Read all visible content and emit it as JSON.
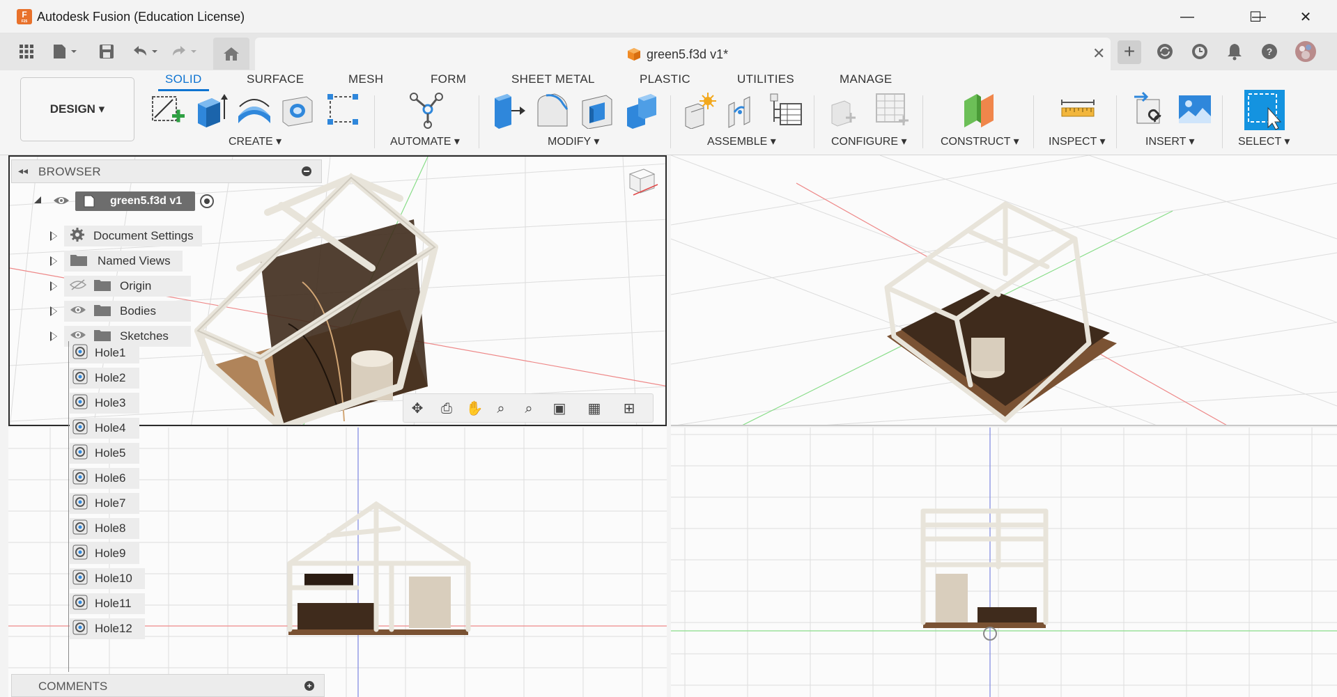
{
  "window": {
    "title": "Autodesk Fusion (Education License)",
    "logo_letter": "F",
    "logo_sub": "F25",
    "minimize": "—",
    "maximize": "☐",
    "close": "✕"
  },
  "document_tab": {
    "name": "green5.f3d v1*",
    "close": "✕"
  },
  "workspace": {
    "design_label": "DESIGN ▾",
    "tabs": [
      "SOLID",
      "SURFACE",
      "MESH",
      "FORM",
      "SHEET METAL",
      "PLASTIC",
      "UTILITIES",
      "MANAGE"
    ],
    "active_tab": "SOLID",
    "groups": [
      "CREATE ▾",
      "AUTOMATE ▾",
      "MODIFY ▾",
      "ASSEMBLE ▾",
      "CONFIGURE ▾",
      "CONSTRUCT ▾",
      "INSPECT ▾",
      "INSERT ▾",
      "SELECT ▾"
    ]
  },
  "browser": {
    "title": "BROWSER",
    "root": "green5.f3d v1",
    "items": [
      {
        "label": "Document Settings",
        "icon": "gear-icon"
      },
      {
        "label": "Named Views",
        "icon": "folder-icon"
      },
      {
        "label": "Origin",
        "icon": "folder-icon",
        "hidden": true
      },
      {
        "label": "Bodies",
        "icon": "folder-icon"
      },
      {
        "label": "Sketches",
        "icon": "folder-icon"
      }
    ],
    "features": [
      "Hole1",
      "Hole2",
      "Hole3",
      "Hole4",
      "Hole5",
      "Hole6",
      "Hole7",
      "Hole8",
      "Hole9",
      "Hole10",
      "Hole11",
      "Hole12"
    ]
  },
  "comments": {
    "title": "COMMENTS",
    "add": "+"
  },
  "colors": {
    "accent": "#0f74d1",
    "frame": "#e8e4da",
    "wood_dark": "#3f2b1c",
    "wood_light": "#b0845a",
    "axis_red": "#e04848",
    "axis_green": "#38c24a",
    "axis_blue": "#3a4fd0"
  }
}
